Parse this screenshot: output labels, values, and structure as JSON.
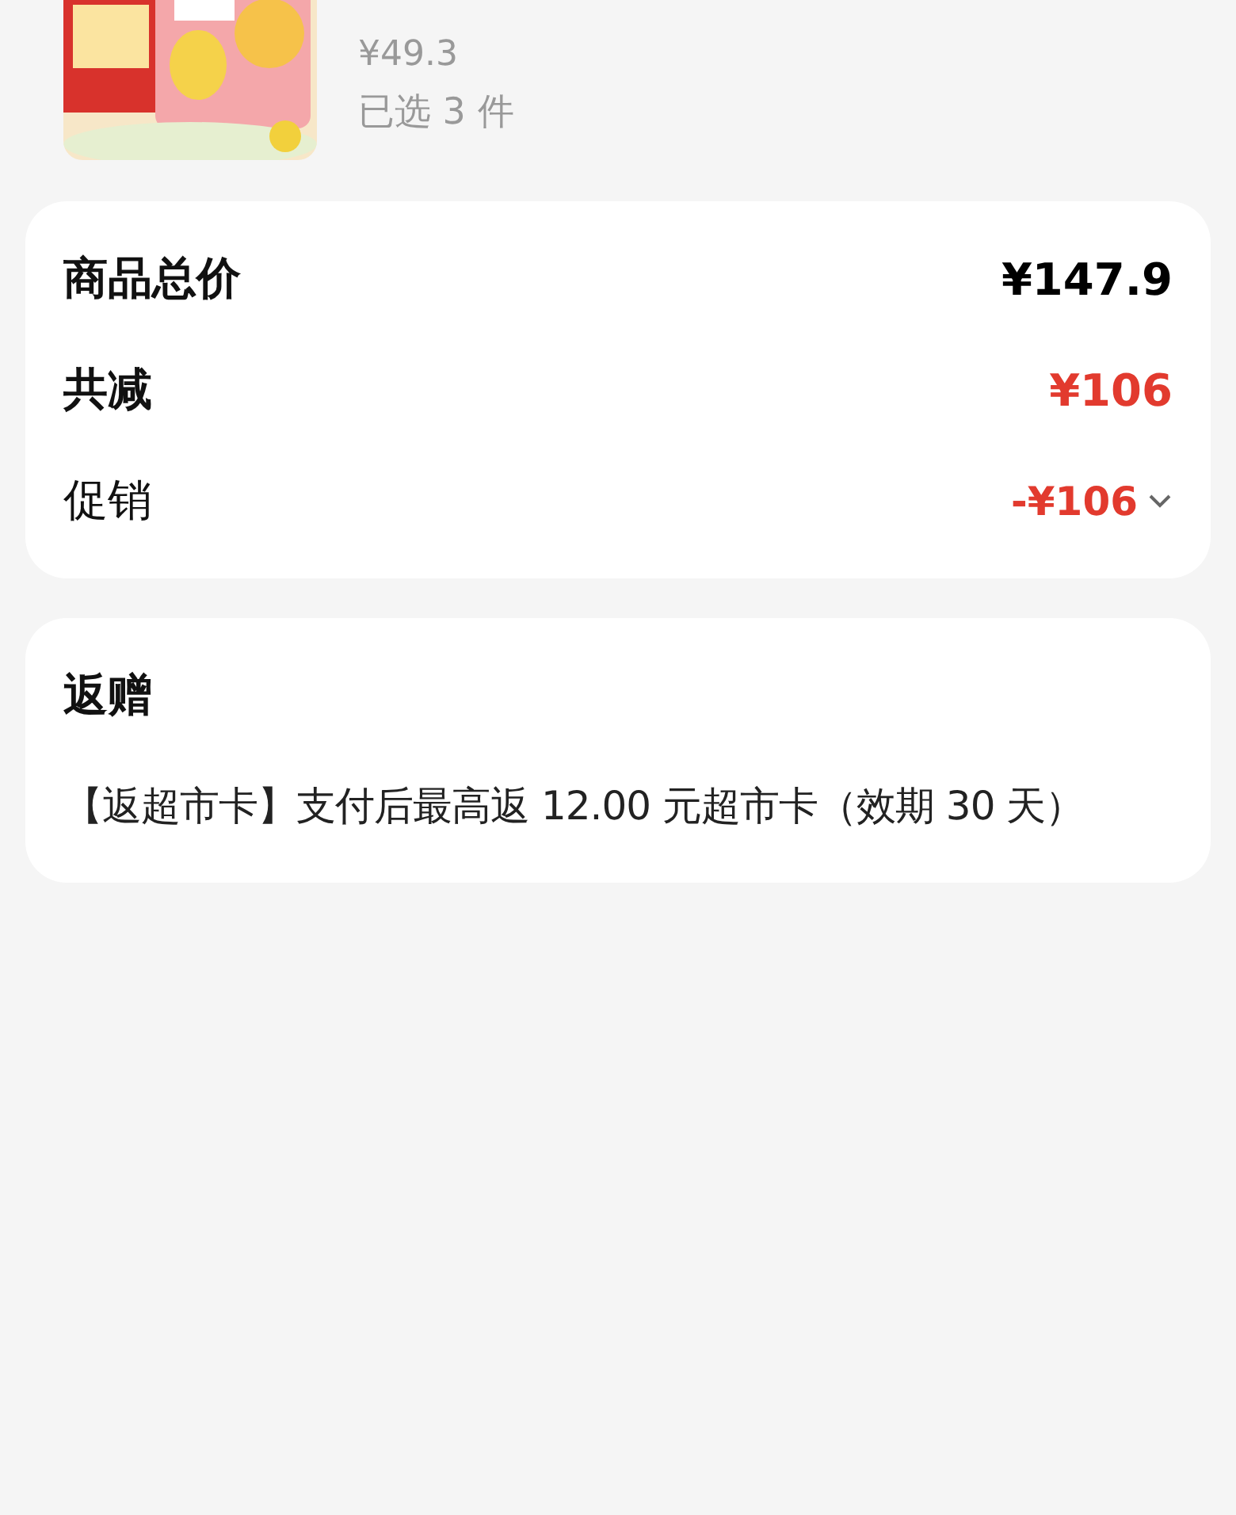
{
  "product": {
    "price": "¥49.3",
    "selected_count": "已选 3 件"
  },
  "summary": {
    "rows": [
      {
        "kind": "total",
        "label": "商品总价",
        "value": "¥147.9"
      },
      {
        "kind": "reduction",
        "label": "共减",
        "value": "¥106"
      },
      {
        "kind": "detail",
        "label": "促销",
        "value": "-¥106",
        "expanded": false
      }
    ]
  },
  "gift": {
    "title": "返赠",
    "text": "【返超市卡】支付后最高返 12.00 元超市卡（效期 30 天）"
  }
}
